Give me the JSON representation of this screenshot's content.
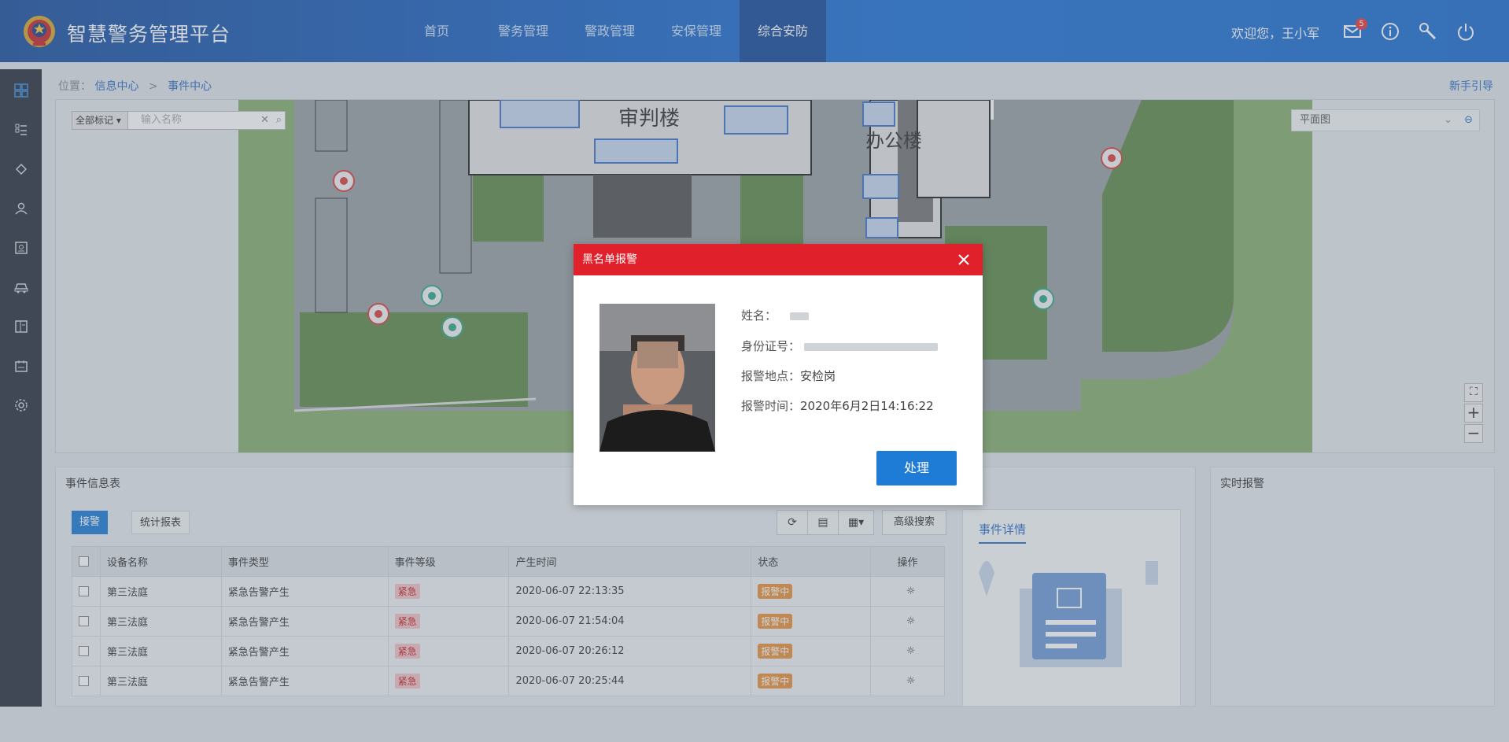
{
  "header": {
    "app_title": "智慧警务管理平台",
    "nav": [
      {
        "label": "首页"
      },
      {
        "label": "警务管理"
      },
      {
        "label": "警政管理"
      },
      {
        "label": "安保管理"
      },
      {
        "label": "综合安防",
        "active": true
      }
    ],
    "welcome": "欢迎您，王小军",
    "mail_badge": "5",
    "icons": [
      "mail-icon",
      "info-icon",
      "wrench-icon",
      "power-icon"
    ]
  },
  "sidebar": {
    "icons": [
      "dashboard-icon",
      "list-icon",
      "shield-icon",
      "user-icon",
      "id-card-icon",
      "car-icon",
      "document-icon",
      "calendar-icon",
      "settings-icon"
    ]
  },
  "breadcrumb": {
    "prefix": "位置：",
    "items": [
      "信息中心",
      "事件中心"
    ],
    "separator": ">"
  },
  "guide_link": "新手引导",
  "map": {
    "filter_select": "全部标记",
    "search_placeholder": "输入名称",
    "view_select": "平面图",
    "labels": {
      "courthouse": "审判楼",
      "office": "办公楼"
    }
  },
  "events": {
    "title": "事件信息表",
    "tabs": [
      "接警",
      "统计报表"
    ],
    "advanced_search": "高级搜索",
    "columns": [
      "设备名称",
      "事件类型",
      "事件等级",
      "产生时间",
      "状态",
      "操作"
    ],
    "rows": [
      {
        "device": "第三法庭",
        "type": "紧急告警产生",
        "level": "紧急",
        "time": "2020-06-07 22:13:35",
        "status": "报警中"
      },
      {
        "device": "第三法庭",
        "type": "紧急告警产生",
        "level": "紧急",
        "time": "2020-06-07 21:54:04",
        "status": "报警中"
      },
      {
        "device": "第三法庭",
        "type": "紧急告警产生",
        "level": "紧急",
        "time": "2020-06-07 20:26:12",
        "status": "报警中"
      },
      {
        "device": "第三法庭",
        "type": "紧急告警产生",
        "level": "紧急",
        "time": "2020-06-07 20:25:44",
        "status": "报警中"
      }
    ]
  },
  "detail": {
    "tab": "事件详情"
  },
  "realtime": {
    "title": "实时报警"
  },
  "modal": {
    "title": "黑名单报警",
    "name_label": "姓名：",
    "id_label": "身份证号：",
    "location_label": "报警地点：",
    "location_value": "安检岗",
    "time_label": "报警时间：",
    "time_value": "2020年6月2日14:16:22",
    "process_button": "处理"
  },
  "colors": {
    "header": "#1f63c2",
    "nav_active": "#174a9a",
    "sidebar": "#2a323d",
    "primary": "#1e7bd6",
    "modal_header": "#e0202a",
    "status_orange": "#e8903a",
    "level_red": "#c41e23",
    "device_orange": "#e08a2a"
  }
}
